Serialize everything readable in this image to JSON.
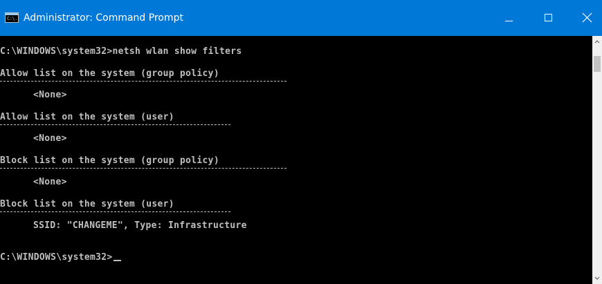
{
  "window": {
    "title": "Administrator: Command Prompt",
    "icon": "cmd-icon",
    "icon_text": "C:\\.",
    "accent_color": "#0078d7",
    "controls": {
      "minimize": "minimize-icon",
      "maximize": "maximize-icon",
      "close": "close-icon"
    }
  },
  "console": {
    "text_color": "#c0c0c0",
    "background_color": "#000000",
    "lines": [
      "C:\\WINDOWS\\system32>netsh wlan show filters",
      "Allow list on the system (group policy)",
      "<None>",
      "Allow list on the system (user)",
      "<None>",
      "Block list on the system (group policy)",
      "<None>",
      "Block list on the system (user)",
      "SSID: \"CHANGEME\", Type: Infrastructure",
      "C:\\WINDOWS\\system32>"
    ]
  },
  "scrollbar": {
    "up": "chevron-up-icon",
    "down": "chevron-down-icon"
  }
}
